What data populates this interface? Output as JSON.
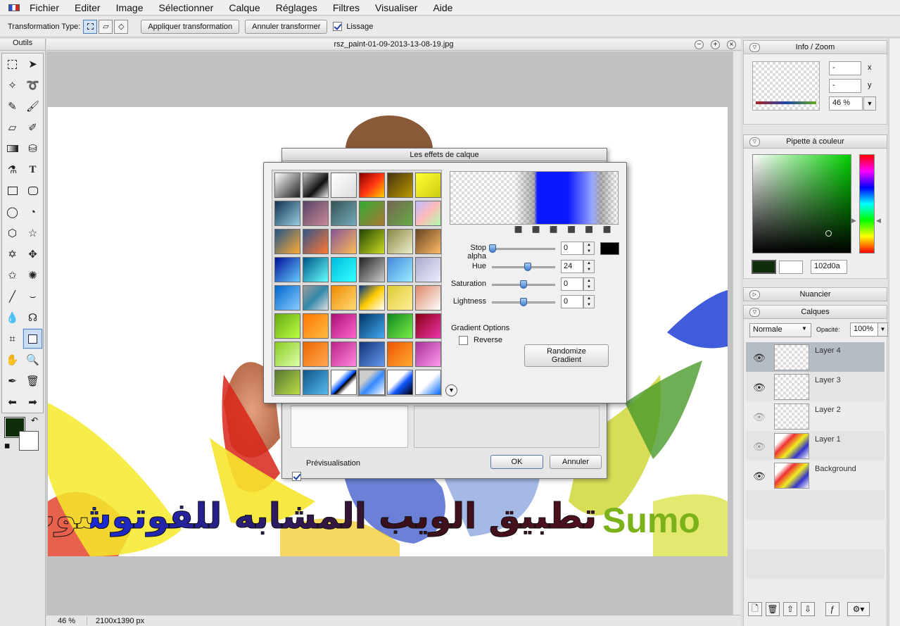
{
  "menu": [
    "Fichier",
    "Editer",
    "Image",
    "Sélectionner",
    "Calque",
    "Réglages",
    "Filtres",
    "Visualiser",
    "Aide"
  ],
  "options": {
    "transform_label": "Transformation Type:",
    "apply_btn": "Appliquer transformation",
    "cancel_btn": "Annuler transformer",
    "smoothing_label": "Lissage",
    "smoothing_checked": true
  },
  "tools": {
    "title": "Outils",
    "primary_color": "#102d0a"
  },
  "document": {
    "filename": "rsz_paint-01-09-2013-13-08-19.jpg",
    "arabic_text": "تطبيق الويب المشابه للفوتوشوب",
    "sumo_text": "Sumo",
    "zoom": "46 %",
    "size": "2100x1390 px"
  },
  "info_zoom": {
    "title": "Info / Zoom",
    "x_value": "-",
    "y_value": "-",
    "x_label": "x",
    "y_label": "y",
    "zoom": "46 %"
  },
  "color_picker": {
    "title": "Pipette à couleur",
    "hex": "102d0a",
    "current": "#102d0a"
  },
  "swatches": {
    "title": "Nuancier"
  },
  "layers": {
    "title": "Calques",
    "blend_mode": "Normale",
    "opacity_label": "Opacité:",
    "opacity": "100%",
    "items": [
      {
        "name": "Layer 4"
      },
      {
        "name": "Layer 3"
      },
      {
        "name": "Layer 2"
      },
      {
        "name": "Layer 1"
      },
      {
        "name": "Background"
      }
    ]
  },
  "dialog": {
    "title": "Les effets de calque",
    "preview_label": "Prévisualisation",
    "ok": "OK",
    "cancel": "Annuler"
  },
  "gradient_editor": {
    "stop_alpha_label": "Stop alpha",
    "stop_alpha": "0",
    "hue_label": "Hue",
    "hue": "24",
    "saturation_label": "Saturation",
    "saturation": "0",
    "lightness_label": "Lightness",
    "lightness": "0",
    "options_label": "Gradient Options",
    "reverse_label": "Reverse",
    "randomize_btn": "Randomize Gradient",
    "stop_color": "#000000"
  }
}
